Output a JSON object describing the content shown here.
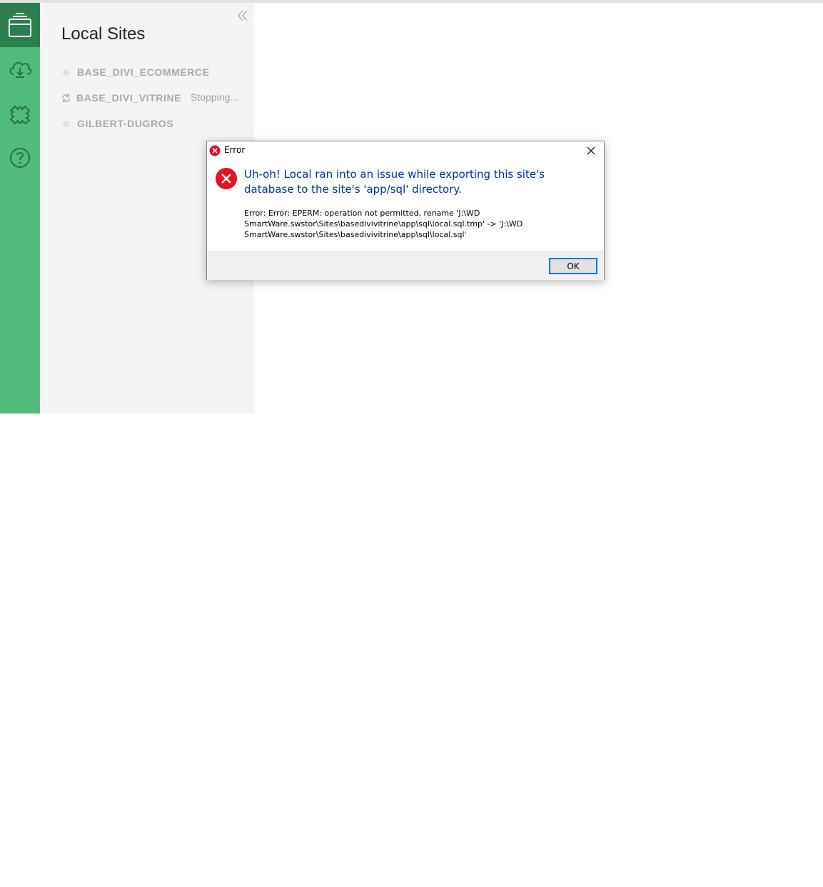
{
  "rail": {
    "items": [
      {
        "icon": "sites-icon",
        "active": true
      },
      {
        "icon": "cloud-connect-icon",
        "active": false
      },
      {
        "icon": "add-ons-puzzle-icon",
        "active": false
      },
      {
        "icon": "help-icon",
        "active": false
      }
    ],
    "colors": {
      "rail": "#51bb7b",
      "active": "#2b7f4f"
    }
  },
  "panel": {
    "title": "Local Sites",
    "collapse_icon": "double-chevron-left-icon",
    "sites": [
      {
        "name": "BASE_DIVI_ECOMMERCE",
        "status": "",
        "state_icon": "status-dot-icon"
      },
      {
        "name": "BASE_DIVI_VITRINE",
        "status": "Stopping...",
        "state_icon": "spinner-icon"
      },
      {
        "name": "GILBERT-DUGROS",
        "status": "",
        "state_icon": "status-dot-icon"
      }
    ]
  },
  "dialog": {
    "title": "Error",
    "main_instruction": "Uh-oh! Local ran into an issue while exporting this site's database to the site's 'app/sql' directory.",
    "detail_lines": [
      "Error: Error: EPERM: operation not permitted, rename 'J:\\WD",
      "SmartWare.swstor\\Sites\\basedivivitrine\\app\\sql\\local.sql.tmp' -> 'J:\\WD",
      "SmartWare.swstor\\Sites\\basedivivitrine\\app\\sql\\local.sql'"
    ],
    "ok_label": "OK",
    "colors": {
      "main_text": "#003399",
      "error_icon": "#e81123",
      "button_border": "#0078d7"
    }
  }
}
